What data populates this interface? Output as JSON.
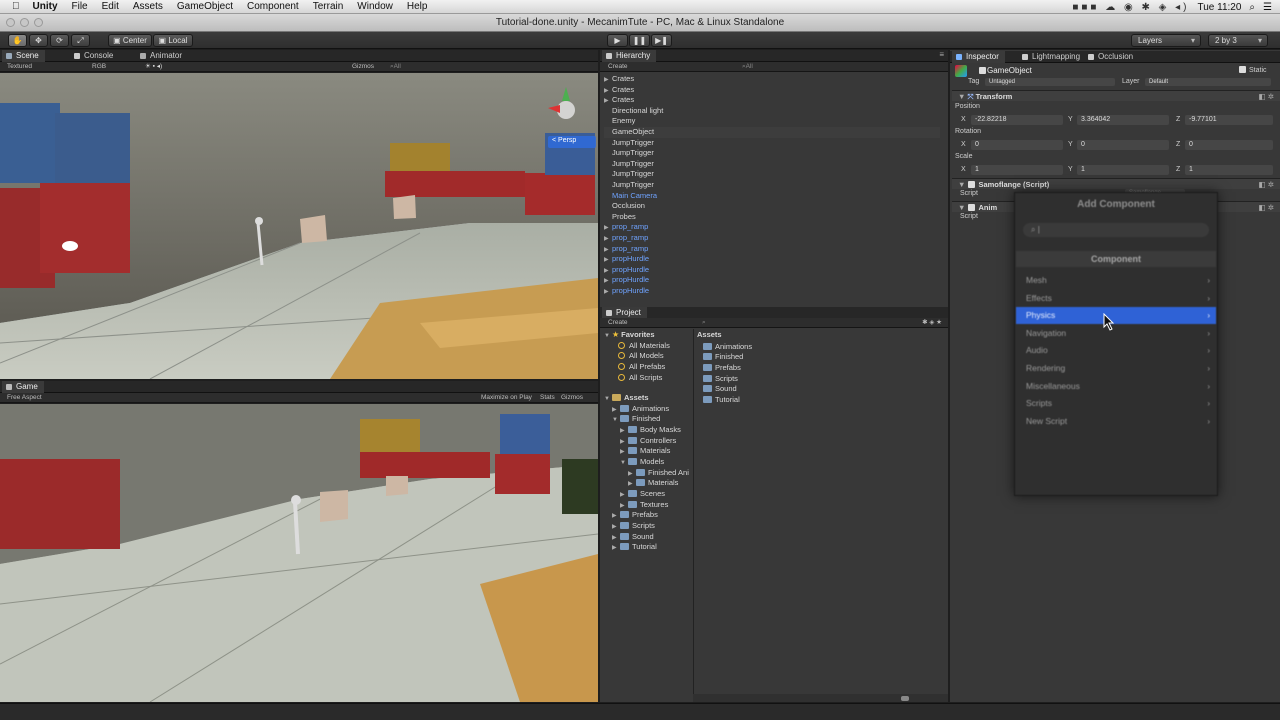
{
  "menubar": {
    "app": "Unity",
    "items": [
      "File",
      "Edit",
      "Assets",
      "GameObject",
      "Component",
      "Terrain",
      "Window",
      "Help"
    ],
    "clock": "Tue 11:20"
  },
  "window": {
    "title": "Tutorial-done.unity - MecanimTute - PC, Mac & Linux Standalone"
  },
  "toolbar": {
    "center": "Center",
    "local": "Local",
    "layers": "Layers",
    "layout": "2 by 3"
  },
  "scene": {
    "tabs": [
      "Scene",
      "Console",
      "Animator"
    ],
    "shading": "Textured",
    "render_mode": "RGB",
    "gizmos": "Gizmos",
    "search": "All",
    "persp": "< Persp"
  },
  "game": {
    "tab": "Game",
    "aspect": "Free Aspect",
    "maximize": "Maximize on Play",
    "stats": "Stats",
    "gizmos": "Gizmos"
  },
  "hierarchy": {
    "tab": "Hierarchy",
    "create": "Create",
    "search": "All",
    "items": [
      {
        "label": "Crates",
        "arrow": true,
        "color": "white"
      },
      {
        "label": "Crates",
        "arrow": true,
        "color": "white"
      },
      {
        "label": "Crates",
        "arrow": true,
        "color": "white"
      },
      {
        "label": "Directional light",
        "arrow": false,
        "color": "white"
      },
      {
        "label": "Enemy",
        "arrow": false,
        "color": "white"
      },
      {
        "label": "GameObject",
        "arrow": false,
        "color": "white",
        "selected": true
      },
      {
        "label": "JumpTrigger",
        "arrow": false,
        "color": "white"
      },
      {
        "label": "JumpTrigger",
        "arrow": false,
        "color": "white"
      },
      {
        "label": "JumpTrigger",
        "arrow": false,
        "color": "white"
      },
      {
        "label": "JumpTrigger",
        "arrow": false,
        "color": "white"
      },
      {
        "label": "JumpTrigger",
        "arrow": false,
        "color": "white"
      },
      {
        "label": "Main Camera",
        "arrow": false,
        "color": "blue"
      },
      {
        "label": "Occlusion",
        "arrow": false,
        "color": "white"
      },
      {
        "label": "Probes",
        "arrow": false,
        "color": "white"
      },
      {
        "label": "prop_ramp",
        "arrow": true,
        "color": "blue"
      },
      {
        "label": "prop_ramp",
        "arrow": true,
        "color": "blue"
      },
      {
        "label": "prop_ramp",
        "arrow": true,
        "color": "blue"
      },
      {
        "label": "propHurdle",
        "arrow": true,
        "color": "blue"
      },
      {
        "label": "propHurdle",
        "arrow": true,
        "color": "blue"
      },
      {
        "label": "propHurdle",
        "arrow": true,
        "color": "blue"
      },
      {
        "label": "propHurdle",
        "arrow": true,
        "color": "blue"
      }
    ]
  },
  "project": {
    "tab": "Project",
    "create": "Create",
    "favorites_label": "Favorites",
    "favorites": [
      "All Materials",
      "All Models",
      "All Prefabs",
      "All Scripts"
    ],
    "assets_label": "Assets",
    "tree": [
      {
        "label": "Animations",
        "depth": 1
      },
      {
        "label": "Finished",
        "depth": 1,
        "open": true
      },
      {
        "label": "Body Masks",
        "depth": 2
      },
      {
        "label": "Controllers",
        "depth": 2
      },
      {
        "label": "Materials",
        "depth": 2
      },
      {
        "label": "Models",
        "depth": 2,
        "open": true
      },
      {
        "label": "Finished Ani",
        "depth": 3
      },
      {
        "label": "Materials",
        "depth": 3
      },
      {
        "label": "Scenes",
        "depth": 2
      },
      {
        "label": "Textures",
        "depth": 2
      },
      {
        "label": "Prefabs",
        "depth": 1
      },
      {
        "label": "Scripts",
        "depth": 1
      },
      {
        "label": "Sound",
        "depth": 1
      },
      {
        "label": "Tutorial",
        "depth": 1
      }
    ],
    "breadcrumb": "Assets",
    "contents": [
      "Animations",
      "Finished",
      "Prefabs",
      "Scripts",
      "Sound",
      "Tutorial"
    ]
  },
  "inspector": {
    "tabs": [
      "Inspector",
      "Lightmapping",
      "Occlusion"
    ],
    "object_name": "GameObject",
    "static_label": "Static",
    "tag_label": "Tag",
    "tag_value": "Untagged",
    "layer_label": "Layer",
    "layer_value": "Default",
    "transform_label": "Transform",
    "position_label": "Position",
    "position": {
      "x": "-22.82218",
      "y": "3.364042",
      "z": "-9.77101"
    },
    "rotation_label": "Rotation",
    "rotation": {
      "x": "0",
      "y": "0",
      "z": "0"
    },
    "scale_label": "Scale",
    "scale": {
      "x": "1",
      "y": "1",
      "z": "1"
    },
    "comp1": "Samoflange (Script)",
    "script_label": "Script",
    "comp1_script": "Samoflange",
    "comp2": "Anim",
    "script_label2": "Script"
  },
  "add_component": {
    "title": "Add Component",
    "search_placeholder": "",
    "header": "Component",
    "items": [
      "Mesh",
      "Effects",
      "Physics",
      "Navigation",
      "Audio",
      "Rendering",
      "Miscellaneous",
      "Scripts",
      "New Script"
    ],
    "highlighted": "Physics"
  }
}
